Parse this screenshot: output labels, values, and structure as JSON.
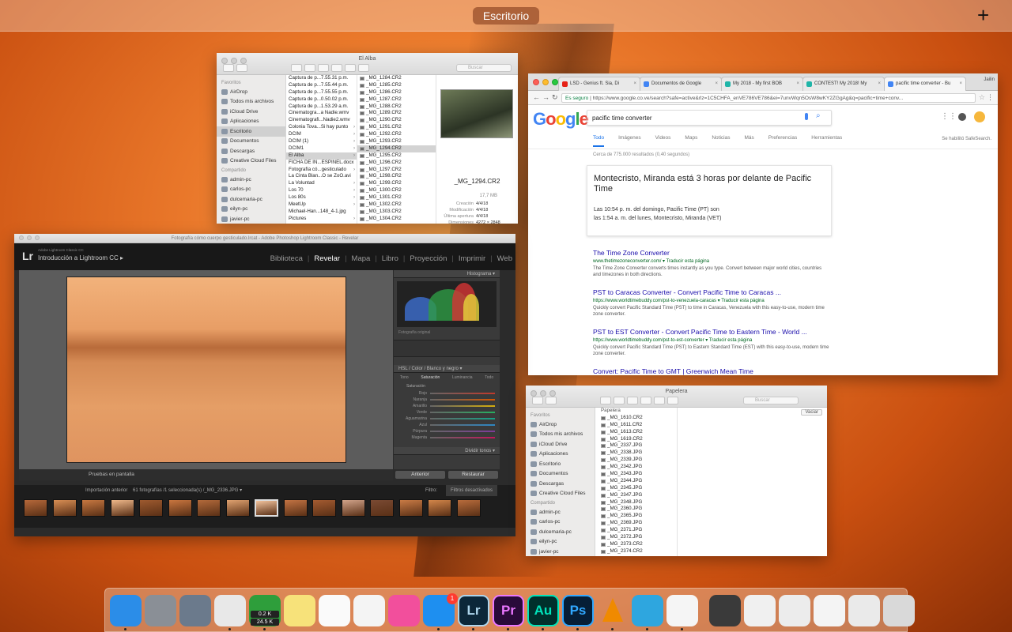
{
  "top_bar": {
    "desktop_label": "Escritorio",
    "add_label": "+"
  },
  "finder1": {
    "title": "El Alba",
    "search_placeholder": "Buscar",
    "sidebar_head_fav": "Favoritos",
    "favorites": [
      "AirDrop",
      "Todos mis archivos",
      "iCloud Drive",
      "Aplicaciones",
      "Escritorio",
      "Documentos",
      "Descargas",
      "Creative Cloud Files"
    ],
    "sidebar_head_shared": "Compartido",
    "shared": [
      "admin-pc",
      "carlos-pc",
      "dulcemaria-pc",
      "eilyn-pc",
      "javier-pc"
    ],
    "col1": [
      "Captura de p...7.55.31 p.m.",
      "Captura de p...7.55.44 p.m.",
      "Captura de p...7.55.55 p.m.",
      "Captura de p...0.50.02 p.m.",
      "Captura de p...1.53.29 a.m.",
      "Cinematogra...a Nadie.wmv",
      "Cinematografi...Nadie2.wmv",
      "Colonia Tova...Si hay punto",
      "DCIM",
      "DCIM (1)",
      "DCIM1",
      "El Alba",
      "FICHA DE IN...ESPINEL.docx",
      "Fotografía có...gesticulado",
      "La Cinta Blan...O se ZoO.avi",
      "La Voluntad",
      "Los 70",
      "Los 80s",
      "MeetUp",
      "Michael-Han...148_4-1.jpg",
      "Pictures"
    ],
    "col2": [
      "_MG_1284.CR2",
      "_MG_1285.CR2",
      "_MG_1286.CR2",
      "_MG_1287.CR2",
      "_MG_1288.CR2",
      "_MG_1289.CR2",
      "_MG_1290.CR2",
      "_MG_1291.CR2",
      "_MG_1292.CR2",
      "_MG_1293.CR2",
      "_MG_1294.CR2",
      "_MG_1295.CR2",
      "_MG_1296.CR2",
      "_MG_1297.CR2",
      "_MG_1298.CR2",
      "_MG_1299.CR2",
      "_MG_1300.CR2",
      "_MG_1301.CR2",
      "_MG_1302.CR2",
      "_MG_1303.CR2",
      "_MG_1304.CR2"
    ],
    "preview_name": "_MG_1294.CR2",
    "preview_size": "17,7 MB",
    "info": [
      {
        "k": "Creación",
        "v": "4/4/18"
      },
      {
        "k": "Modificación",
        "v": "4/4/18"
      },
      {
        "k": "Última apertura",
        "v": "4/4/18"
      },
      {
        "k": "Dimensiones",
        "v": "4272 × 2848"
      }
    ],
    "add_tags": "Añadir"
  },
  "chrome": {
    "tabs": [
      {
        "label": "LSD - Genius ft. Sia, Di",
        "color": "#e62117"
      },
      {
        "label": "Documentos de Google",
        "color": "#4285f4"
      },
      {
        "label": "My 2018 - My first BOB",
        "color": "#1fb5a8"
      },
      {
        "label": "CONTEST! My 2018! My",
        "color": "#1fb5a8"
      },
      {
        "label": "pacific time converter - Bu",
        "color": "#4285f4"
      }
    ],
    "profile": "Jailin",
    "secure_label": "Es seguro",
    "url": "https://www.google.co.ve/search?safe=active&rlz=1C5CHFA_enVE786VE786&ei=7unvWqn5OsW8wKY2ZGgAg&q=pacific+time+conv...",
    "logo": "Google",
    "query": "pacific time converter",
    "nav_tabs": [
      "Todo",
      "Imágenes",
      "Videos",
      "Maps",
      "Noticias",
      "Más",
      "Preferencias",
      "Herramientas"
    ],
    "safesearch": "Se habilitó SafeSearch.",
    "results_count": "Cerca de 775.000 resultados (0,40 segundos)",
    "card_heading": "Montecristo, Miranda está 3 horas por delante de Pacific Time",
    "card_line1": "Las 10:54 p. m. del domingo, Pacific Time (PT) son",
    "card_line2": "las 1:54 a. m. del lunes, Montecristo, Miranda (VET)",
    "results": [
      {
        "title": "The Time Zone Converter",
        "url": "www.thetimezoneconverter.com/ ▾ Traducir esta página",
        "snippet": "The Time Zone Converter converts times instantly as you type. Convert between major world cities, countries and timezones in both directions."
      },
      {
        "title": "PST to Caracas Converter - Convert Pacific Time to Caracas ...",
        "url": "https://www.worldtimebuddy.com/pst-to-venezuela-caracas ▾ Traducir esta página",
        "snippet": "Quickly convert Pacific Standard Time (PST) to time in Caracas, Venezuela with this easy-to-use, modern time zone converter."
      },
      {
        "title": "PST to EST Converter - Convert Pacific Time to Eastern Time - World ...",
        "url": "https://www.worldtimebuddy.com/pst-to-est-converter ▾ Traducir esta página",
        "snippet": "Quickly convert Pacific Standard Time (PST) to Eastern Standard Time (EST) with this easy-to-use, modern time zone converter."
      },
      {
        "title": "Convert: Pacific Time to GMT | Greenwich Mean Time",
        "url": "",
        "snippet": ""
      }
    ]
  },
  "lightroom": {
    "window_title": "Fotografía cómo cuerpo gesticulado.lrcat - Adobe Photoshop Lightroom Classic - Revelar",
    "brand_sub": "Adobe Lightroom Classic CC",
    "catalog": "Introducción a Lightroom CC ▸",
    "modules": [
      "Biblioteca",
      "Revelar",
      "Mapa",
      "Libro",
      "Proyección",
      "Imprimir",
      "Web"
    ],
    "active_module": "Revelar",
    "histogram_label": "Histograma ▾",
    "original_photo": "Fotografía original",
    "hsl_tabs": "HSL / Color / Blanco y negro ▾",
    "hsl_sub": [
      "Tono",
      "Saturación",
      "Luminancia",
      "Todo"
    ],
    "saturation_label": "Saturación",
    "hsl_rows": [
      "Rojo",
      "Naranja",
      "Amarillo",
      "Verde",
      "Aguamarina",
      "Azul",
      "Púrpura",
      "Magenta"
    ],
    "split_toning": "Dividir tonos ▾",
    "soft_proof": "Pruebas en pantalla",
    "prev_btn": "Anterior",
    "reset_btn": "Restaurar",
    "filmstrip_source": "Importación anterior",
    "filmstrip_info": "61 fotografías /1 seleccionada(s) /_MG_2336.JPG ▾",
    "filter_label": "Filtro:",
    "filter_value": "Filtros desactivados"
  },
  "finder2": {
    "title": "Papelera",
    "search_placeholder": "Buscar",
    "empty_btn": "Vaciar",
    "folder": "Papelera",
    "sidebar_head_fav": "Favoritos",
    "favorites": [
      "AirDrop",
      "Todos mis archivos",
      "iCloud Drive",
      "Aplicaciones",
      "Escritorio",
      "Documentos",
      "Descargas",
      "Creative Cloud Files"
    ],
    "sidebar_head_shared": "Compartido",
    "shared": [
      "admin-pc",
      "carlos-pc",
      "dulcemaria-pc",
      "eilyn-pc",
      "javier-pc"
    ],
    "files": [
      "_MG_1610.CR2",
      "_MG_1611.CR2",
      "_MG_1613.CR2",
      "_MG_1619.CR2",
      "_MG_2337.JPG",
      "_MG_2338.JPG",
      "_MG_2339.JPG",
      "_MG_2342.JPG",
      "_MG_2343.JPG",
      "_MG_2344.JPG",
      "_MG_2345.JPG",
      "_MG_2347.JPG",
      "_MG_2348.JPG",
      "_MG_2360.JPG",
      "_MG_2365.JPG",
      "_MG_2369.JPG",
      "_MG_2371.JPG",
      "_MG_2372.JPG",
      "_MG_2373.CR2",
      "_MG_2374.CR2"
    ]
  },
  "dock": {
    "activity_up": "0.2 K",
    "activity_down": "24.5 K",
    "appstore_badge": "1",
    "apps": [
      {
        "name": "finder",
        "label": "",
        "color": "#2b8de8"
      },
      {
        "name": "system-preferences",
        "label": "",
        "color": "#8a8f96"
      },
      {
        "name": "launchpad",
        "label": "",
        "color": "#6b7a8c"
      },
      {
        "name": "chrome",
        "label": "",
        "color": "#e8e8e8"
      },
      {
        "name": "activity-monitor",
        "label": "",
        "color": "#2e9e3b"
      },
      {
        "name": "notes",
        "label": "",
        "color": "#f7e27a"
      },
      {
        "name": "reminders",
        "label": "",
        "color": "#fafafa"
      },
      {
        "name": "photos",
        "label": "",
        "color": "#f4f4f4"
      },
      {
        "name": "itunes",
        "label": "",
        "color": "#f24f9c"
      },
      {
        "name": "app-store",
        "label": "",
        "color": "#1e8ff0"
      },
      {
        "name": "lightroom",
        "label": "Lr",
        "color": "#0c2739"
      },
      {
        "name": "premiere",
        "label": "Pr",
        "color": "#2a0a3a"
      },
      {
        "name": "audition",
        "label": "Au",
        "color": "#00302c"
      },
      {
        "name": "photoshop",
        "label": "Ps",
        "color": "#061e36"
      },
      {
        "name": "vlc",
        "label": "",
        "color": "rgba(0,0,0,0)"
      },
      {
        "name": "telegram",
        "label": "",
        "color": "#2ea6df"
      },
      {
        "name": "textedit",
        "label": "",
        "color": "#f5f5f5"
      },
      {
        "name": "recent-1",
        "label": "",
        "color": "#3a3a3a"
      },
      {
        "name": "recent-2",
        "label": "",
        "color": "#f0f0f0"
      },
      {
        "name": "recent-3",
        "label": "",
        "color": "#ececec"
      },
      {
        "name": "recent-4",
        "label": "",
        "color": "#f4f4f4"
      },
      {
        "name": "recent-5",
        "label": "",
        "color": "#eaeaea"
      },
      {
        "name": "trash",
        "label": "",
        "color": "#d9d9d9"
      }
    ]
  }
}
